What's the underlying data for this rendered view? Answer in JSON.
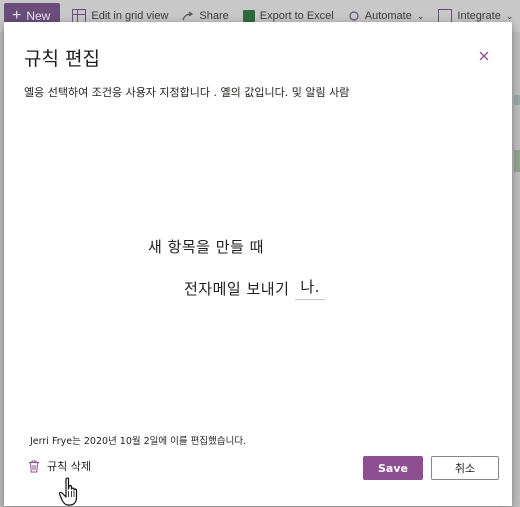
{
  "toolbar": {
    "new_label": "New",
    "edit_grid_label": "Edit in grid view",
    "share_label": "Share",
    "export_label": "Export to Excel",
    "automate_label": "Automate",
    "integrate_label": "Integrate"
  },
  "dialog": {
    "title": "규칙 편집",
    "subtitle": "옐응 선택하여 조건응 사용자 지정합니다 . 옐의 값입니다. 및 알림 사람",
    "condition_line1": "새 항목을 만들 때",
    "condition_line2_prefix": "전자메일 보내기",
    "recipient_value": "나.",
    "edited_by": "Jerri Frye는 2020년 10월 2일에 이를 편집했습니다.",
    "delete_label": "규칙 삭제",
    "save_label": "Save",
    "cancel_label": "취소"
  },
  "colors": {
    "accent": "#8f4d92",
    "close_icon": "#8f4d92"
  }
}
